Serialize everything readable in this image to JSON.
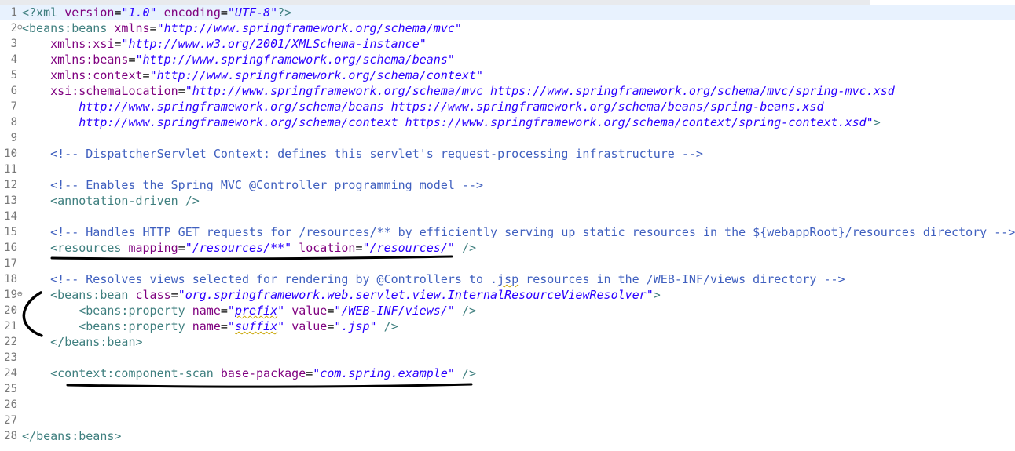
{
  "editor": {
    "lines": [
      {
        "n": "1",
        "fold": "",
        "html": "<span class='pi'>&lt;?xml</span> <span class='an'>version</span>=<span class='av'>\"1.0\"</span> <span class='an'>encoding</span>=<span class='av'>\"UTF-8\"</span><span class='pi'>?&gt;</span>",
        "current": true
      },
      {
        "n": "2",
        "fold": "⊖",
        "html": "<span class='tag'>&lt;</span><span class='tn'>beans:beans</span> <span class='an'>xmlns</span>=<span class='av'>\"http://www.springframework.org/schema/mvc\"</span>"
      },
      {
        "n": "3",
        "fold": "",
        "html": "    <span class='an'>xmlns:xsi</span>=<span class='av'>\"http://www.w3.org/2001/XMLSchema-instance\"</span>"
      },
      {
        "n": "4",
        "fold": "",
        "html": "    <span class='an'>xmlns:beans</span>=<span class='av'>\"http://www.springframework.org/schema/beans\"</span>"
      },
      {
        "n": "5",
        "fold": "",
        "html": "    <span class='an'>xmlns:context</span>=<span class='av'>\"http://www.springframework.org/schema/context\"</span>"
      },
      {
        "n": "6",
        "fold": "",
        "html": "    <span class='an'>xsi:schemaLocation</span>=<span class='av'>\"http://www.springframework.org/schema/mvc https://www.springframework.org/schema/mvc/spring-mvc.xsd</span>"
      },
      {
        "n": "7",
        "fold": "",
        "html": "        <span class='av'>http://www.springframework.org/schema/beans https://www.springframework.org/schema/beans/spring-beans.xsd</span>"
      },
      {
        "n": "8",
        "fold": "",
        "html": "        <span class='av'>http://www.springframework.org/schema/context https://www.springframework.org/schema/context/spring-context.xsd\"</span><span class='tag'>&gt;</span>"
      },
      {
        "n": "9",
        "fold": "",
        "html": ""
      },
      {
        "n": "10",
        "fold": "",
        "html": "    <span class='cm'>&lt;!-- DispatcherServlet Context: defines this servlet's request-processing infrastructure --&gt;</span>"
      },
      {
        "n": "11",
        "fold": "",
        "html": ""
      },
      {
        "n": "12",
        "fold": "",
        "html": "    <span class='cm'>&lt;!-- Enables the Spring MVC @Controller programming model --&gt;</span>"
      },
      {
        "n": "13",
        "fold": "",
        "html": "    <span class='tag'>&lt;</span><span class='tn'>annotation-driven</span> <span class='tag'>/&gt;</span>"
      },
      {
        "n": "14",
        "fold": "",
        "html": ""
      },
      {
        "n": "15",
        "fold": "",
        "html": "    <span class='cm'>&lt;!-- Handles HTTP GET requests for /resources/** by efficiently serving up static resources in the ${webappRoot}/resources directory --&gt;</span>"
      },
      {
        "n": "16",
        "fold": "",
        "html": "    <span class='tag'>&lt;</span><span class='tn'>resources</span> <span class='an'>mapping</span>=<span class='av'>\"/resources/**\"</span> <span class='an'>location</span>=<span class='av'>\"/resources/\"</span> <span class='tag'>/&gt;</span>"
      },
      {
        "n": "17",
        "fold": "",
        "html": ""
      },
      {
        "n": "18",
        "fold": "",
        "html": "    <span class='cm'>&lt;!-- Resolves views selected for rendering by @Controllers to .<span class='sq'>jsp</span> resources in the /WEB-INF/views directory --&gt;</span>"
      },
      {
        "n": "19",
        "fold": "⊖",
        "html": "    <span class='tag'>&lt;</span><span class='tn'>beans:bean</span> <span class='an'>class</span>=<span class='av'>\"org.springframework.web.servlet.view.InternalResourceViewResolver\"</span><span class='tag'>&gt;</span>"
      },
      {
        "n": "20",
        "fold": "",
        "html": "        <span class='tag'>&lt;</span><span class='tn'>beans:property</span> <span class='an'>name</span>=<span class='av'>\"<span class='sq'>prefix</span>\"</span> <span class='an'>value</span>=<span class='av'>\"/WEB-INF/views/\"</span> <span class='tag'>/&gt;</span>"
      },
      {
        "n": "21",
        "fold": "",
        "html": "        <span class='tag'>&lt;</span><span class='tn'>beans:property</span> <span class='an'>name</span>=<span class='av'>\"<span class='sq'>suffix</span>\"</span> <span class='an'>value</span>=<span class='av'>\".jsp\"</span> <span class='tag'>/&gt;</span>"
      },
      {
        "n": "22",
        "fold": "",
        "html": "    <span class='tag'>&lt;/</span><span class='tn'>beans:bean</span><span class='tag'>&gt;</span>"
      },
      {
        "n": "23",
        "fold": "",
        "html": ""
      },
      {
        "n": "24",
        "fold": "",
        "html": "    <span class='tag'>&lt;</span><span class='tn'>context:component-scan</span> <span class='an'>base-package</span>=<span class='av'>\"com.spring.example\"</span> <span class='tag'>/&gt;</span>"
      },
      {
        "n": "25",
        "fold": "",
        "html": ""
      },
      {
        "n": "26",
        "fold": "",
        "html": ""
      },
      {
        "n": "27",
        "fold": "",
        "html": ""
      },
      {
        "n": "28",
        "fold": "",
        "html": "<span class='tag'>&lt;/</span><span class='tn'>beans:beans</span><span class='tag'>&gt;</span>"
      }
    ]
  },
  "colors": {
    "tag": "#3f7f7f",
    "attribute": "#7f007f",
    "value": "#2a00ff",
    "comment": "#3f5fbf",
    "ink": "#000000"
  }
}
